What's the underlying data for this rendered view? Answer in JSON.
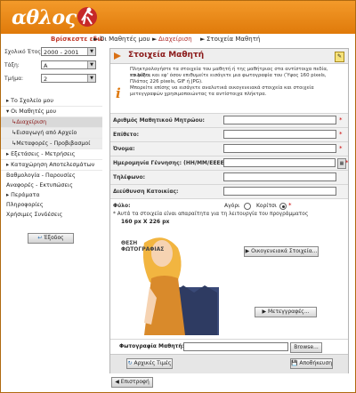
{
  "app": {
    "logo_text": "αθλος"
  },
  "breadcrumb": {
    "start": "Βρίσκεστε εδώ",
    "item1": "Οι Μαθητές μου",
    "item2": "Διαχείριση",
    "item3": "Στοιχεία Μαθητή"
  },
  "sidebar": {
    "school_year_label": "Σχολικό Έτος:",
    "school_year_value": "2000 - 2001",
    "class_label": "Τάξη:",
    "class_value": "A",
    "section_label": "Τμήμα:",
    "section_value": "2",
    "items": [
      {
        "label": "Το Σχολείο μου"
      },
      {
        "label": "Οι Μαθητές μου"
      },
      {
        "label": "Διαχείριση"
      },
      {
        "label": "Εισαγωγή από Αρχείο"
      },
      {
        "label": "Μεταφορές - Προβιβασμοί"
      },
      {
        "label": "Εξετάσεις - Μετρήσεις"
      },
      {
        "label": "Καταχώρηση Αποτελεσμάτων"
      },
      {
        "label": "Βαθμολογία - Παρουσίες"
      },
      {
        "label": "Αναφορές - Εκτυπώσεις"
      },
      {
        "label": "Περάματα"
      },
      {
        "label": "Πληροφορίες"
      },
      {
        "label": "Χρήσιμες Συνδέσεις"
      }
    ],
    "exit_label": "Έξοδος"
  },
  "main": {
    "title": "Στοιχεία Μαθητή",
    "info_lines": [
      "Πληκτρολογήστε τα στοιχεία του μαθητή ή της μαθήτριας στα αντίστοιχα πεδία, επιλέξτε",
      "το φύλο, και εφ' όσον επιθυμείτε εισάγετε μια φωτογραφία του (Ύψος 160 pixels,",
      "Πλάτος 226 pixels, GIF ή JPG).",
      "Μπορείτε επίσης να εισάγετε αναλυτικά οικογενειακά στοιχεία και στοιχεία",
      "μετεγγραφών χρησιμοποιώντας τα αντίστοιχα πλήκτρα."
    ],
    "fields": [
      {
        "label": "Αριθμός Μαθητικού Μητρώου:"
      },
      {
        "label": "Επίθετο:"
      },
      {
        "label": "Όνομα:"
      },
      {
        "label": "Ημερομηνία Γέννησης: (ΗΗ/ΜΜ/ΕΕΕΕ)"
      },
      {
        "label": "Τηλέφωνο:"
      },
      {
        "label": "Διεύθυνση Κατοικίας:"
      }
    ],
    "gender_label": "Φύλο:",
    "gender_male": "Αγόρι",
    "gender_female": "Κορίτσι",
    "note": "* Αυτά τα στοιχεία είναι απαραίτητα για τη λειτουργία του προγράμματος",
    "photo_size": "160 px X 226 px",
    "photo_caption_1": "ΘΕΣΗ",
    "photo_caption_2": "ΦΩΤΟΓΡΑΦΙΑΣ",
    "family_button": "Οικογενειακά Στοιχεία...",
    "transfers_button": "Μετεγγραφές...",
    "photo_label": "Φωτογραφία Μαθητή:",
    "browse_button": "Browse...",
    "clear_button": "Αρχικές Τιμές",
    "save_button": "Αποθήκευση",
    "back_button": "Επιστροφή"
  }
}
